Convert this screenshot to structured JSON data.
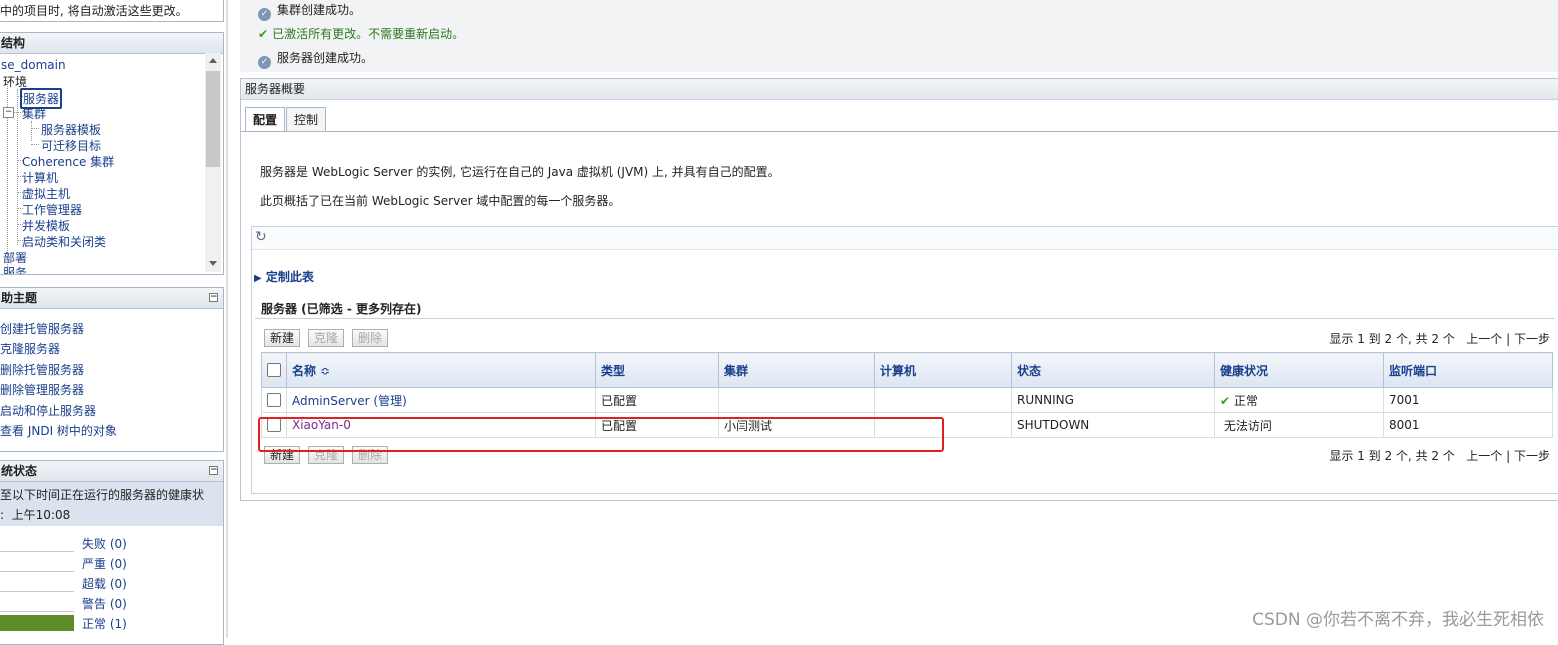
{
  "left": {
    "top_notice": "中的项目时, 将自动激活这些更改。",
    "domain_structure": {
      "title": "结构",
      "items": [
        "se_domain",
        "环境",
        "服务器",
        "集群",
        "服务器模板",
        "可迁移目标",
        "Coherence 集群",
        "计算机",
        "虚拟主机",
        "工作管理器",
        "并发模板",
        "启动类和关闭类",
        "部署",
        "服务"
      ]
    },
    "help_topics": {
      "title": "助主题",
      "collapse": "−",
      "items": [
        "创建托管服务器",
        "克隆服务器",
        "删除托管服务器",
        "删除管理服务器",
        "启动和停止服务器",
        "查看 JNDI 树中的对象"
      ]
    },
    "system_status": {
      "title": "统状态",
      "collapse": "−",
      "desc_line1": "至以下时间正在运行的服务器的健康状",
      "desc_line2": "上午10:08",
      "rows": [
        {
          "label": "失败 (0)",
          "fill": 0,
          "color": "#e0e0e0"
        },
        {
          "label": "严重 (0)",
          "fill": 0,
          "color": "#e0e0e0"
        },
        {
          "label": "超载 (0)",
          "fill": 0,
          "color": "#e0e0e0"
        },
        {
          "label": "警告 (0)",
          "fill": 0,
          "color": "#e0e0e0"
        },
        {
          "label": "正常 (1)",
          "fill": 1,
          "color": "#5e8c2a"
        }
      ]
    }
  },
  "messages": [
    {
      "icon": "info",
      "text": "集群创建成功。"
    },
    {
      "icon": "check",
      "text": "已激活所有更改。不需要重新启动。"
    },
    {
      "icon": "info",
      "text": "服务器创建成功。"
    }
  ],
  "main": {
    "title": "服务器概要",
    "tabs": [
      "配置",
      "控制"
    ],
    "desc1": "服务器是 WebLogic Server 的实例, 它运行在自己的 Java 虚拟机 (JVM) 上, 并具有自己的配置。",
    "desc2": "此页概括了已在当前 WebLogic Server 域中配置的每一个服务器。",
    "customize": "定制此表",
    "table_title": "服务器 (已筛选 - 更多列存在)",
    "buttons": {
      "new": "新建",
      "clone": "克隆",
      "delete": "删除"
    },
    "pager": {
      "info": "显示 1 到 2 个, 共 2 个",
      "prev": "上一个",
      "next": "下一步"
    },
    "columns": [
      "名称",
      "类型",
      "集群",
      "计算机",
      "状态",
      "健康状况",
      "监听端口"
    ],
    "sort_indicator": "≎",
    "rows": [
      {
        "name": "AdminServer (管理)",
        "type": "已配置",
        "cluster": "",
        "machine": "",
        "state": "RUNNING",
        "health": "正常",
        "health_ok": true,
        "port": "7001"
      },
      {
        "name": "XiaoYan-0",
        "type": "已配置",
        "cluster": "小闫测试",
        "machine": "",
        "state": "SHUTDOWN",
        "health": "无法访问",
        "health_ok": false,
        "port": "8001"
      }
    ]
  },
  "watermark": "CSDN @你若不离不弃，我必生死相依"
}
